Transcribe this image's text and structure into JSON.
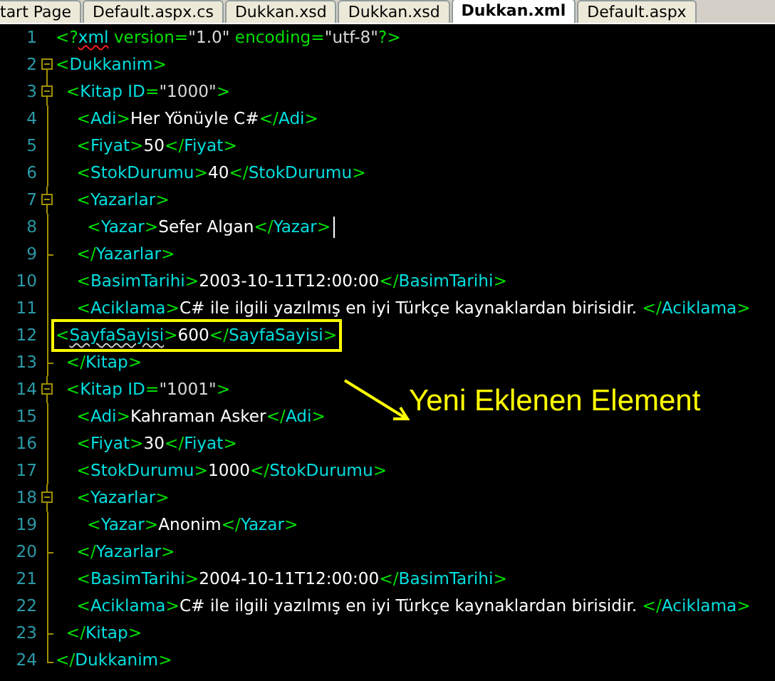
{
  "tabs": [
    {
      "label": "tart Page",
      "selected": false
    },
    {
      "label": "Default.aspx.cs",
      "selected": false
    },
    {
      "label": "Dukkan.xsd",
      "selected": false
    },
    {
      "label": "Dukkan.xsd",
      "selected": false
    },
    {
      "label": "Dukkan.xml",
      "selected": true
    },
    {
      "label": "Default.aspx",
      "selected": false
    }
  ],
  "editor": {
    "lines": [
      {
        "number": "1",
        "kind": "plain",
        "segments": [
          {
            "kind": "punct",
            "text": "<?"
          },
          {
            "kind": "tag",
            "text": "xml",
            "error": true
          },
          {
            "kind": "punct",
            "text": " version="
          },
          {
            "kind": "value",
            "text": "\"1.0\""
          },
          {
            "kind": "punct",
            "text": " encoding="
          },
          {
            "kind": "value",
            "text": "\"utf-8\""
          },
          {
            "kind": "punct",
            "text": "?>"
          }
        ]
      },
      {
        "number": "2",
        "kind": "open",
        "segments": [
          {
            "kind": "punct",
            "text": "<"
          },
          {
            "kind": "tag",
            "text": "Dukkanim"
          },
          {
            "kind": "punct",
            "text": ">"
          }
        ]
      },
      {
        "number": "3",
        "kind": "open",
        "segments": [
          {
            "kind": "punct",
            "text": "  <"
          },
          {
            "kind": "tag",
            "text": "Kitap ID"
          },
          {
            "kind": "punct",
            "text": "="
          },
          {
            "kind": "value",
            "text": "\"1000\""
          },
          {
            "kind": "punct",
            "text": ">"
          }
        ]
      },
      {
        "number": "4",
        "kind": "inner",
        "segments": [
          {
            "kind": "punct",
            "text": "    <"
          },
          {
            "kind": "tag",
            "text": "Adi"
          },
          {
            "kind": "punct",
            "text": ">"
          },
          {
            "kind": "text",
            "text": "Her Yönüyle C#"
          },
          {
            "kind": "punct",
            "text": "</"
          },
          {
            "kind": "tag",
            "text": "Adi"
          },
          {
            "kind": "punct",
            "text": ">"
          }
        ]
      },
      {
        "number": "5",
        "kind": "inner",
        "segments": [
          {
            "kind": "punct",
            "text": "    <"
          },
          {
            "kind": "tag",
            "text": "Fiyat"
          },
          {
            "kind": "punct",
            "text": ">"
          },
          {
            "kind": "text",
            "text": "50"
          },
          {
            "kind": "punct",
            "text": "</"
          },
          {
            "kind": "tag",
            "text": "Fiyat"
          },
          {
            "kind": "punct",
            "text": ">"
          }
        ]
      },
      {
        "number": "6",
        "kind": "inner",
        "segments": [
          {
            "kind": "punct",
            "text": "    <"
          },
          {
            "kind": "tag",
            "text": "StokDurumu"
          },
          {
            "kind": "punct",
            "text": ">"
          },
          {
            "kind": "text",
            "text": "40"
          },
          {
            "kind": "punct",
            "text": "</"
          },
          {
            "kind": "tag",
            "text": "StokDurumu"
          },
          {
            "kind": "punct",
            "text": ">"
          }
        ]
      },
      {
        "number": "7",
        "kind": "open",
        "segments": [
          {
            "kind": "punct",
            "text": "    <"
          },
          {
            "kind": "tag",
            "text": "Yazarlar"
          },
          {
            "kind": "punct",
            "text": ">"
          }
        ]
      },
      {
        "number": "8",
        "kind": "inner",
        "caret": true,
        "segments": [
          {
            "kind": "punct",
            "text": "      <"
          },
          {
            "kind": "tag",
            "text": "Yazar"
          },
          {
            "kind": "punct",
            "text": ">"
          },
          {
            "kind": "text",
            "text": "Sefer Algan"
          },
          {
            "kind": "punct",
            "text": "</"
          },
          {
            "kind": "tag",
            "text": "Yazar"
          },
          {
            "kind": "punct",
            "text": ">"
          }
        ]
      },
      {
        "number": "9",
        "kind": "close",
        "segments": [
          {
            "kind": "punct",
            "text": "    </"
          },
          {
            "kind": "tag",
            "text": "Yazarlar"
          },
          {
            "kind": "punct",
            "text": ">"
          }
        ]
      },
      {
        "number": "10",
        "kind": "inner",
        "segments": [
          {
            "kind": "punct",
            "text": "    <"
          },
          {
            "kind": "tag",
            "text": "BasimTarihi"
          },
          {
            "kind": "punct",
            "text": ">"
          },
          {
            "kind": "text",
            "text": "2003-10-11T12:00:00"
          },
          {
            "kind": "punct",
            "text": "</"
          },
          {
            "kind": "tag",
            "text": "BasimTarihi"
          },
          {
            "kind": "punct",
            "text": ">"
          }
        ]
      },
      {
        "number": "11",
        "kind": "inner",
        "segments": [
          {
            "kind": "punct",
            "text": "    <"
          },
          {
            "kind": "tag",
            "text": "Aciklama"
          },
          {
            "kind": "punct",
            "text": ">"
          },
          {
            "kind": "text",
            "text": "C# ile ilgili yazılmış en iyi Türkçe kaynaklardan birisidir. "
          },
          {
            "kind": "punct",
            "text": "</"
          },
          {
            "kind": "tag",
            "text": "Aciklama"
          },
          {
            "kind": "punct",
            "text": ">"
          }
        ]
      },
      {
        "number": "12",
        "kind": "inner",
        "highlighted": true,
        "segments": [
          {
            "kind": "punct",
            "text": "<"
          },
          {
            "kind": "tag",
            "text": "SayfaSayisi",
            "warning": true
          },
          {
            "kind": "punct",
            "text": ">"
          },
          {
            "kind": "text",
            "text": "600"
          },
          {
            "kind": "punct",
            "text": "</"
          },
          {
            "kind": "tag",
            "text": "SayfaSayisi"
          },
          {
            "kind": "punct",
            "text": ">"
          }
        ]
      },
      {
        "number": "13",
        "kind": "close",
        "segments": [
          {
            "kind": "punct",
            "text": "  </"
          },
          {
            "kind": "tag",
            "text": "Kitap"
          },
          {
            "kind": "punct",
            "text": ">"
          }
        ]
      },
      {
        "number": "14",
        "kind": "open",
        "segments": [
          {
            "kind": "punct",
            "text": "  <"
          },
          {
            "kind": "tag",
            "text": "Kitap ID"
          },
          {
            "kind": "punct",
            "text": "="
          },
          {
            "kind": "value",
            "text": "\"1001\""
          },
          {
            "kind": "punct",
            "text": ">"
          }
        ]
      },
      {
        "number": "15",
        "kind": "inner",
        "segments": [
          {
            "kind": "punct",
            "text": "    <"
          },
          {
            "kind": "tag",
            "text": "Adi"
          },
          {
            "kind": "punct",
            "text": ">"
          },
          {
            "kind": "text",
            "text": "Kahraman Asker"
          },
          {
            "kind": "punct",
            "text": "</"
          },
          {
            "kind": "tag",
            "text": "Adi"
          },
          {
            "kind": "punct",
            "text": ">"
          }
        ]
      },
      {
        "number": "16",
        "kind": "inner",
        "segments": [
          {
            "kind": "punct",
            "text": "    <"
          },
          {
            "kind": "tag",
            "text": "Fiyat"
          },
          {
            "kind": "punct",
            "text": ">"
          },
          {
            "kind": "text",
            "text": "30"
          },
          {
            "kind": "punct",
            "text": "</"
          },
          {
            "kind": "tag",
            "text": "Fiyat"
          },
          {
            "kind": "punct",
            "text": ">"
          }
        ]
      },
      {
        "number": "17",
        "kind": "inner",
        "segments": [
          {
            "kind": "punct",
            "text": "    <"
          },
          {
            "kind": "tag",
            "text": "StokDurumu"
          },
          {
            "kind": "punct",
            "text": ">"
          },
          {
            "kind": "text",
            "text": "1000"
          },
          {
            "kind": "punct",
            "text": "</"
          },
          {
            "kind": "tag",
            "text": "StokDurumu"
          },
          {
            "kind": "punct",
            "text": ">"
          }
        ]
      },
      {
        "number": "18",
        "kind": "open",
        "segments": [
          {
            "kind": "punct",
            "text": "    <"
          },
          {
            "kind": "tag",
            "text": "Yazarlar"
          },
          {
            "kind": "punct",
            "text": ">"
          }
        ]
      },
      {
        "number": "19",
        "kind": "inner",
        "segments": [
          {
            "kind": "punct",
            "text": "      <"
          },
          {
            "kind": "tag",
            "text": "Yazar"
          },
          {
            "kind": "punct",
            "text": ">"
          },
          {
            "kind": "text",
            "text": "Anonim"
          },
          {
            "kind": "punct",
            "text": "</"
          },
          {
            "kind": "tag",
            "text": "Yazar"
          },
          {
            "kind": "punct",
            "text": ">"
          }
        ]
      },
      {
        "number": "20",
        "kind": "close",
        "segments": [
          {
            "kind": "punct",
            "text": "    </"
          },
          {
            "kind": "tag",
            "text": "Yazarlar"
          },
          {
            "kind": "punct",
            "text": ">"
          }
        ]
      },
      {
        "number": "21",
        "kind": "inner",
        "segments": [
          {
            "kind": "punct",
            "text": "    <"
          },
          {
            "kind": "tag",
            "text": "BasimTarihi"
          },
          {
            "kind": "punct",
            "text": ">"
          },
          {
            "kind": "text",
            "text": "2004-10-11T12:00:00"
          },
          {
            "kind": "punct",
            "text": "</"
          },
          {
            "kind": "tag",
            "text": "BasimTarihi"
          },
          {
            "kind": "punct",
            "text": ">"
          }
        ]
      },
      {
        "number": "22",
        "kind": "inner",
        "segments": [
          {
            "kind": "punct",
            "text": "    <"
          },
          {
            "kind": "tag",
            "text": "Aciklama"
          },
          {
            "kind": "punct",
            "text": ">"
          },
          {
            "kind": "text",
            "text": "C# ile ilgili yazılmış en iyi Türkçe kaynaklardan birisidir. "
          },
          {
            "kind": "punct",
            "text": "</"
          },
          {
            "kind": "tag",
            "text": "Aciklama"
          },
          {
            "kind": "punct",
            "text": ">"
          }
        ]
      },
      {
        "number": "23",
        "kind": "close",
        "segments": [
          {
            "kind": "punct",
            "text": "  </"
          },
          {
            "kind": "tag",
            "text": "Kitap"
          },
          {
            "kind": "punct",
            "text": ">"
          }
        ]
      },
      {
        "number": "24",
        "kind": "end",
        "segments": [
          {
            "kind": "punct",
            "text": "</"
          },
          {
            "kind": "tag",
            "text": "Dukkanim"
          },
          {
            "kind": "punct",
            "text": ">"
          }
        ]
      }
    ]
  },
  "annotation": {
    "text": "Yeni Eklenen Element"
  }
}
